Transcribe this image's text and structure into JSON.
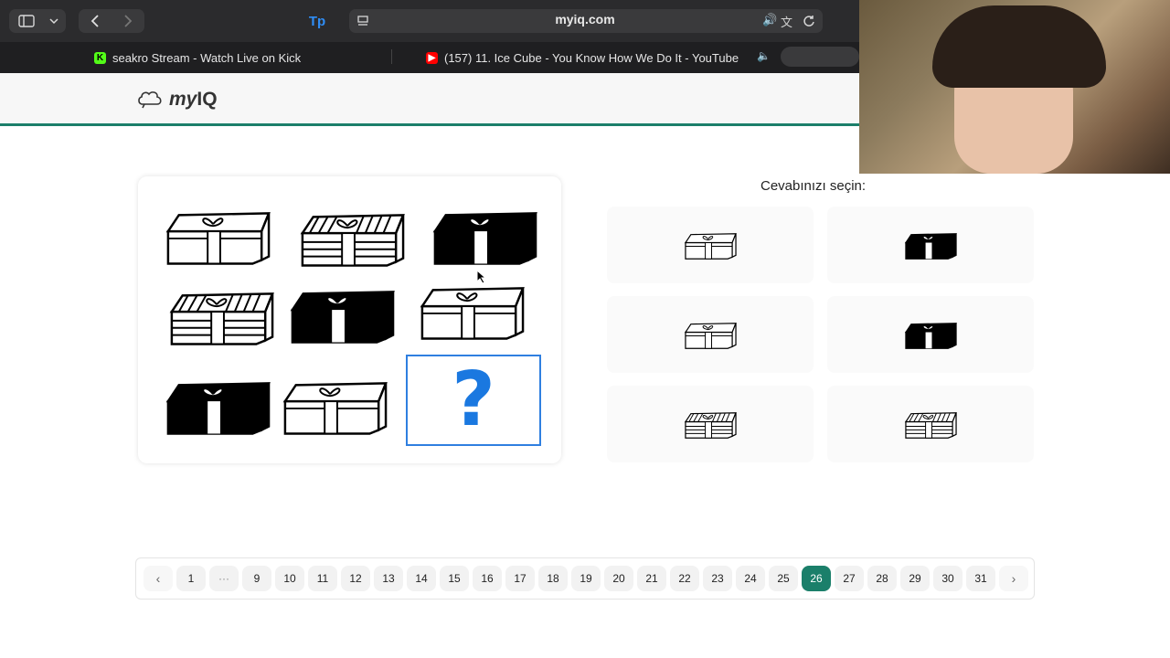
{
  "browser": {
    "url": "myiq.com",
    "extension_label": "Tp",
    "tabs": [
      {
        "title": "seakro Stream - Watch Live on Kick",
        "favicon_color": "#53fc18"
      },
      {
        "title": "(157) 11. Ice Cube - You Know How We Do It - YouTube",
        "favicon_color": "#ff0000"
      }
    ]
  },
  "site": {
    "logo_my": "my",
    "logo_iq": "IQ",
    "accent_color": "#1b7f6a"
  },
  "puzzle": {
    "question_mark": "?",
    "grid": [
      [
        "outline-box",
        "striped-box",
        "black-box"
      ],
      [
        "striped-box",
        "black-box",
        "outline-box"
      ],
      [
        "black-box",
        "outline-box",
        "missing"
      ]
    ]
  },
  "answers": {
    "prompt": "Cevabınızı seçin:",
    "options": [
      "outline-box",
      "black-box",
      "outline-box",
      "black-box",
      "striped-box",
      "striped-box"
    ]
  },
  "pagination": {
    "prev": "‹",
    "next": "›",
    "ellipsis": "···",
    "pages": [
      "1",
      "9",
      "10",
      "11",
      "12",
      "13",
      "14",
      "15",
      "16",
      "17",
      "18",
      "19",
      "20",
      "21",
      "22",
      "23",
      "24",
      "25",
      "26",
      "27",
      "28",
      "29",
      "30",
      "31"
    ],
    "current": "26"
  }
}
